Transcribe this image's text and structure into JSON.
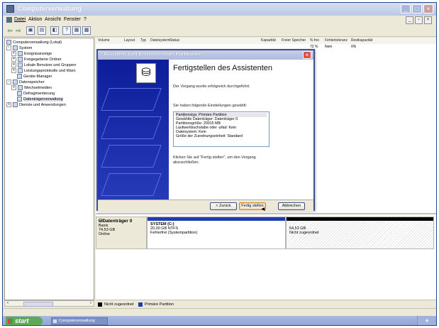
{
  "window": {
    "title": "Computerverwaltung"
  },
  "menu": [
    "Datei",
    "Aktion",
    "Ansicht",
    "Fenster",
    "?"
  ],
  "tree": [
    {
      "label": "Computerverwaltung (Lokal)",
      "level": 0,
      "expander": ""
    },
    {
      "label": "System",
      "level": 1,
      "expander": "-"
    },
    {
      "label": "Ereignisanzeige",
      "level": 2,
      "expander": "+"
    },
    {
      "label": "Freigegebene Ordner",
      "level": 2,
      "expander": "+"
    },
    {
      "label": "Lokale Benutzer und Gruppen",
      "level": 2,
      "expander": "+"
    },
    {
      "label": "Leistungsprotokolle und Warn",
      "level": 2,
      "expander": "+"
    },
    {
      "label": "Geräte-Manager",
      "level": 2,
      "expander": ""
    },
    {
      "label": "Datenspeicher",
      "level": 1,
      "expander": "-"
    },
    {
      "label": "Wechselmedien",
      "level": 2,
      "expander": "+"
    },
    {
      "label": "Defragmentierung",
      "level": 2,
      "expander": ""
    },
    {
      "label": "Datenträgerverwaltung",
      "level": 2,
      "expander": ""
    },
    {
      "label": "Dienste und Anwendungen",
      "level": 1,
      "expander": "+"
    }
  ],
  "columns": [
    "Volume",
    "Layout",
    "Typ",
    "Dateisystem",
    "Status",
    "Kapazität",
    "Freier Speicher",
    "% frei",
    "Fehlertoleranz",
    "Restkapazität"
  ],
  "row_partial": {
    "percent_free": "72 %",
    "fault_tolerance": "Nein",
    "overhead": "0%"
  },
  "disk": {
    "name": "Datenträger 0",
    "type": "Basis",
    "size": "74,53 GB",
    "status": "Online",
    "partitions": [
      {
        "name": "SYSTEM (C:)",
        "size": "20,00 GB NTFS",
        "status": "Fehlerfrei (Systempartition)"
      },
      {
        "name": "",
        "size": "54,53 GB",
        "status": "Nicht zugeordnet"
      }
    ]
  },
  "legend": [
    "Nicht zugeordnet",
    "Primäre Partition"
  ],
  "legend_colors": {
    "unallocated": "#000000",
    "primary": "#1e3cae"
  },
  "wizard": {
    "title": "Assistent zum Erstellen neuer Partitionen",
    "heading": "Fertigstellen des Assistenten",
    "success": "Der Vorgang wurde erfolgreich durchgeführt.",
    "settings_intro": "Sie haben folgende Einstellungen gewählt:",
    "settings": [
      "Partitionstyp: Primäre Partition",
      "Gewählte Datenträger: Datenträger 0",
      "Partitionsgröße: 20015 MB",
      "Laufwerkbuchstabe oder -pfad: Kein",
      "Dateisystem: Kein",
      "Größe der Zuordnungseinheit: Standard"
    ],
    "finish_hint_1": "Klicken Sie auf \"Fertig stellen\", um den Vorgang",
    "finish_hint_2": "abzuschließen.",
    "buttons": {
      "back": "< Zurück",
      "finish": "Fertig stellen",
      "cancel": "Abbrechen"
    }
  },
  "taskbar": {
    "start": "start",
    "item": "Computerverwaltung"
  }
}
